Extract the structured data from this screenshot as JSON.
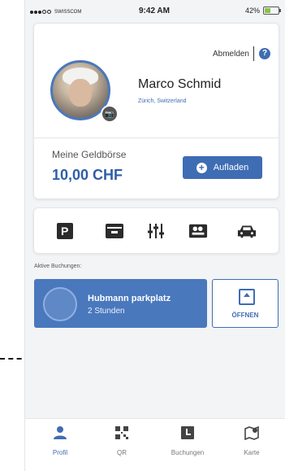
{
  "status": {
    "carrier": "SWISSCOM",
    "time": "9:42 AM",
    "battery": "42%",
    "battery_level": 0.42
  },
  "profile": {
    "logout_label": "Abmelden",
    "name": "Marco Schmid",
    "location": "Zürich, Switzerland",
    "wallet_label": "Meine Geldbörse",
    "wallet_amount": "10,00 CHF",
    "topup_label": "Aufladen",
    "help_symbol": "?"
  },
  "quick_actions": [
    "parking-icon",
    "wallet-icon",
    "filter-sliders-icon",
    "ticket-icon",
    "car-icon"
  ],
  "active_bookings_label": "Aktive Buchungen:",
  "booking": {
    "title": "Hubmann parkplatz",
    "subtitle": "2 Stunden",
    "open_label": "ÖFFNEN"
  },
  "tabs": [
    {
      "label": "Profil",
      "icon": "user-icon",
      "active": true
    },
    {
      "label": "QR",
      "icon": "qr-code-icon",
      "active": false
    },
    {
      "label": "Buchungen",
      "icon": "bookings-icon",
      "active": false
    },
    {
      "label": "Karte",
      "icon": "map-icon",
      "active": false
    }
  ],
  "colors": {
    "accent": "#3f6db3",
    "booking_bg": "#4a78bd",
    "battery": "#8bc34a"
  }
}
